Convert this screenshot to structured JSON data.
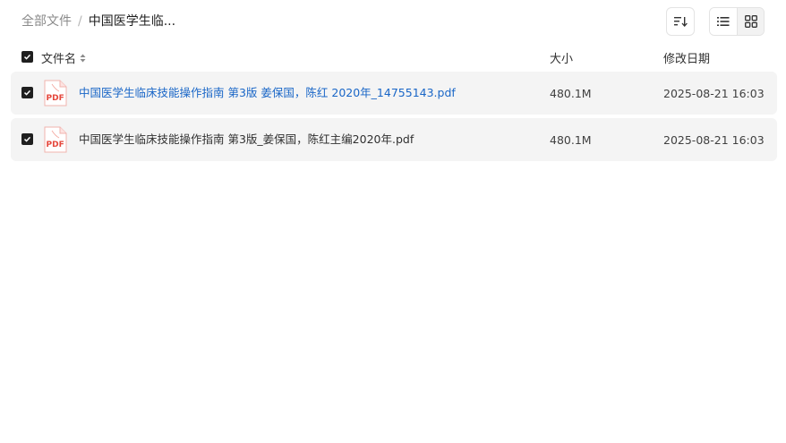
{
  "breadcrumb": {
    "root": "全部文件",
    "separator": "/",
    "current": "中国医学生临..."
  },
  "toolbar": {
    "sort_icon": "sort-descending-icon",
    "list_view_icon": "list-view-icon",
    "grid_view_icon": "grid-view-icon"
  },
  "table": {
    "columns": {
      "name": "文件名",
      "size": "大小",
      "modified": "修改日期"
    },
    "rows": [
      {
        "name": "中国医学生临床技能操作指南 第3版 姜保国，陈红 2020年_14755143.pdf",
        "size": "480.1M",
        "modified": "2025-08-21 16:03",
        "icon_label": "PDF",
        "checked": true
      },
      {
        "name": "中国医学生临床技能操作指南 第3版_姜保国，陈红主编2020年.pdf",
        "size": "480.1M",
        "modified": "2025-08-21 16:03",
        "icon_label": "PDF",
        "checked": true
      }
    ]
  },
  "colors": {
    "link": "#1966c7",
    "row_bg": "#f4f4f4",
    "pdf_red": "#e5473c"
  }
}
